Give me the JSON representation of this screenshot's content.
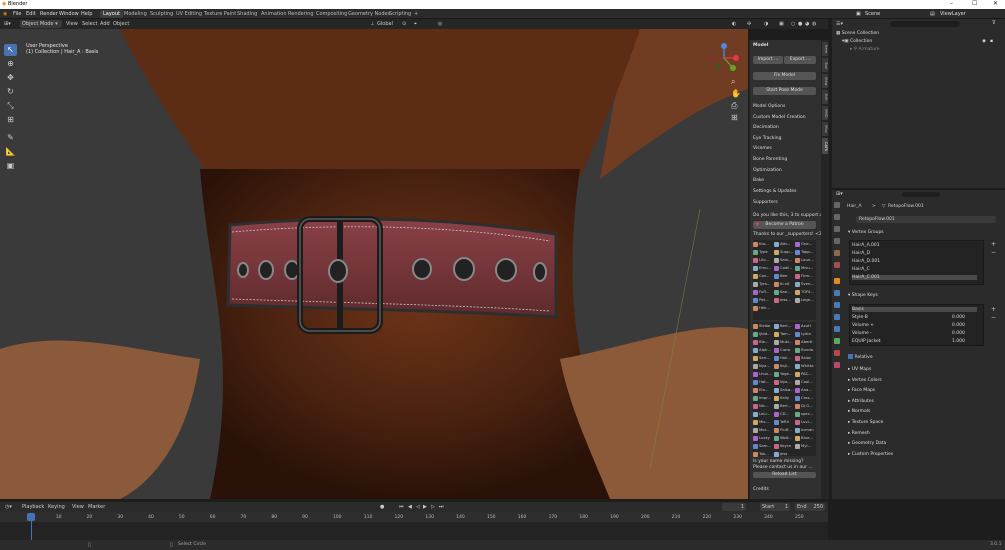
{
  "app": {
    "title": "Blender",
    "version": "3.0.1"
  },
  "menu": [
    "File",
    "Edit",
    "Render",
    "Window",
    "Help"
  ],
  "workspaces": [
    "Layout",
    "Modeling",
    "Sculpting",
    "UV Editing",
    "Texture Paint",
    "Shading",
    "Animation",
    "Rendering",
    "Compositing",
    "Geometry Nodes",
    "Scripting"
  ],
  "workspace_add": "+",
  "scene": {
    "name": "Scene",
    "view_layer": "ViewLayer"
  },
  "viewport_header": {
    "mode": "Object Mode",
    "view": "View",
    "select": "Select",
    "add": "Add",
    "object": "Object",
    "orientation": "Global",
    "options": "Options"
  },
  "viewport": {
    "perspective": "User Perspective",
    "collection_path": "(1) Collection | Hair_A : Basis"
  },
  "npanel": {
    "model_header": "Model",
    "import": "Import ...",
    "export": "Export ...",
    "fix_model": "Fix Model",
    "start_pose": "Start Pose Mode",
    "sections": [
      "Model Options",
      "Custom Model Creation",
      "Decimation",
      "Eye Tracking",
      "Visemes",
      "Bone Parenting",
      "Optimization",
      "Bake",
      "Settings & Updates"
    ],
    "supporters_header": "Supporters",
    "support_prompt": "Do you like this, 3 to support us?",
    "become_patron": "Become a Patron",
    "thanks": "Thanks to our _supporters! <3",
    "supporters_a": [
      "Kro...",
      "Attr...",
      "Gne...",
      "Type",
      "Supp...",
      "Tapp...",
      "Lilo...",
      "Sain...",
      "Laun...",
      "Emu...",
      "Codf...",
      "Misu...",
      "Cov...",
      "Bee",
      "Firm...",
      "Tyra...",
      "Ki.vK",
      "Sven...",
      "Fufl...",
      "Kae...",
      "TORI...",
      "Pet...",
      "Jess...",
      "Lege...",
      "Hek..."
    ],
    "supporters_b": [
      "Striba",
      "Berl...",
      "AzuH",
      "Ijidd...",
      "Tam...",
      "Lydia",
      "Ble...",
      "Muki...",
      "Abertl",
      "Alph...",
      "Curro",
      "Runda",
      "Serr...",
      "Holl...",
      "Salac",
      "Nya...",
      "Kaji...",
      "Whitta",
      "Lhun...",
      "Yoge...",
      "PAC...",
      "Hat...",
      "Nya...",
      "Cool...",
      "Ela...",
      "Salsa...",
      "Ana...",
      "Impr...",
      "Kally",
      "Cros...",
      "Nic...",
      "Berl...",
      "Dj G...",
      "LeLi...",
      "CD...",
      "spec...",
      "Mis...",
      "TeRIl",
      "Luvi...",
      "Mor...",
      "Fluff...",
      "Icenan",
      "Lucky",
      "Wolf...",
      "Blue...",
      "Sam...",
      "Keyra",
      "Myl...",
      "Tok...",
      "jess"
    ],
    "name_missing_1": "Is your name missing?",
    "name_missing_2": "Please contact us in our ...",
    "reload_list": "Reload List",
    "credits": "Credits"
  },
  "ntabs": [
    "Item",
    "Tool",
    "View",
    "Edit",
    "MMD",
    "Misc",
    "CATS"
  ],
  "outliner": {
    "scene_collection": "Scene Collection",
    "collection": "Collection",
    "armature": "Armature"
  },
  "properties": {
    "object": "Hair_A",
    "mesh": "RetopoFlow.001",
    "mesh_field": "RetopoFlow.001",
    "vertex_groups_header": "Vertex Groups",
    "vertex_groups": [
      "HairA_A.001",
      "HairA_D",
      "HairA_D.001",
      "HairA_C",
      "HairA_C.001"
    ],
    "shape_keys_header": "Shape Keys",
    "shape_keys": [
      {
        "name": "Basis",
        "value": ""
      },
      {
        "name": "Style-B",
        "value": "0.000"
      },
      {
        "name": "Volume +",
        "value": "0.000"
      },
      {
        "name": "Volume -",
        "value": "0.000"
      },
      {
        "name": "EQUIP Jacket",
        "value": "1.000"
      }
    ],
    "relative": "Relative",
    "panels": [
      "UV Maps",
      "Vertex Colors",
      "Face Maps",
      "Attributes",
      "Normals",
      "Texture Space",
      "Remesh",
      "Geometry Data",
      "Custom Properties"
    ]
  },
  "timeline": {
    "playback": "Playback",
    "keying": "Keying",
    "view": "View",
    "marker": "Marker",
    "current_frame": "1",
    "start_label": "Start",
    "start": "1",
    "end_label": "End",
    "end": "250",
    "ticks": [
      "1",
      "10",
      "20",
      "30",
      "40",
      "50",
      "60",
      "70",
      "80",
      "90",
      "100",
      "110",
      "120",
      "130",
      "140",
      "150",
      "160",
      "170",
      "180",
      "190",
      "200",
      "210",
      "220",
      "230",
      "240",
      "250"
    ]
  },
  "status": {
    "hint": "Select Circle"
  },
  "colors": {
    "accent": "#4772b3",
    "collar": "#7d3b3f",
    "skin": "#7a3d1e",
    "bg": "#3a3a3a"
  },
  "icons": [
    "blender-logo-icon",
    "cursor-icon",
    "move-icon",
    "rotate-icon",
    "scale-icon",
    "transform-icon",
    "annotate-icon",
    "measure-icon",
    "add-cube-icon",
    "hand-icon",
    "camera-icon",
    "grid-icon",
    "search-icon",
    "eye-icon",
    "camera-small-icon",
    "wrench-icon",
    "gear-icon",
    "heart-icon",
    "play-icon",
    "pause-icon",
    "skip-start-icon",
    "skip-end-icon",
    "filter-icon"
  ]
}
